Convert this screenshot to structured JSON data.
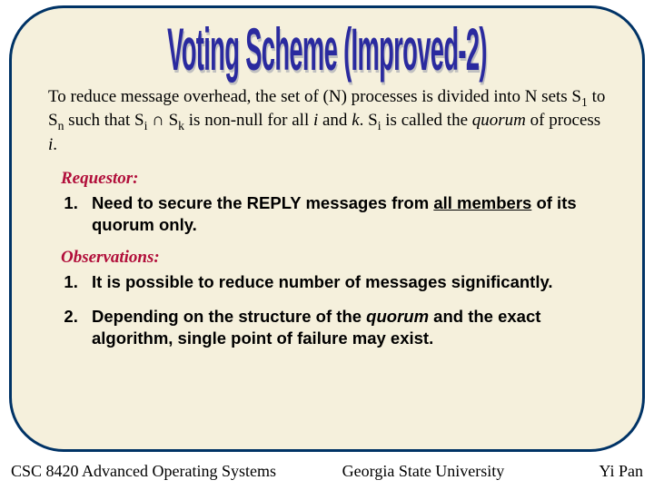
{
  "title": "Voting Scheme (Improved-2)",
  "intro": {
    "p1": "To reduce message overhead, the set of (N) processes is divided into N sets S",
    "s1": "1",
    "p2": " to S",
    "s2": "n",
    "p3": " such that S",
    "s3": "i",
    "p4": " ∩ S",
    "s4": "k",
    "p5": " is non-null for all ",
    "i1": "i",
    "p6": " and ",
    "i2": "k",
    "p7": ". S",
    "s5": "i",
    "p8": " is called the ",
    "i3": "quorum",
    "p9": " of process ",
    "i4": "i",
    "p10": "."
  },
  "requestor": {
    "heading": "Requestor:",
    "items": [
      {
        "pre": "Need to secure the REPLY messages from ",
        "u": "all members",
        "post": " of its quorum only."
      }
    ]
  },
  "observations": {
    "heading": "Observations:",
    "items": [
      {
        "text": "It is possible to reduce number of messages significantly."
      },
      {
        "pre": "Depending on the structure of the ",
        "i": "quorum",
        "post": " and the exact algorithm, single point of failure may exist."
      }
    ]
  },
  "footer": {
    "left": "CSC 8420 Advanced Operating Systems",
    "center": "Georgia State University",
    "right": "Yi Pan"
  }
}
